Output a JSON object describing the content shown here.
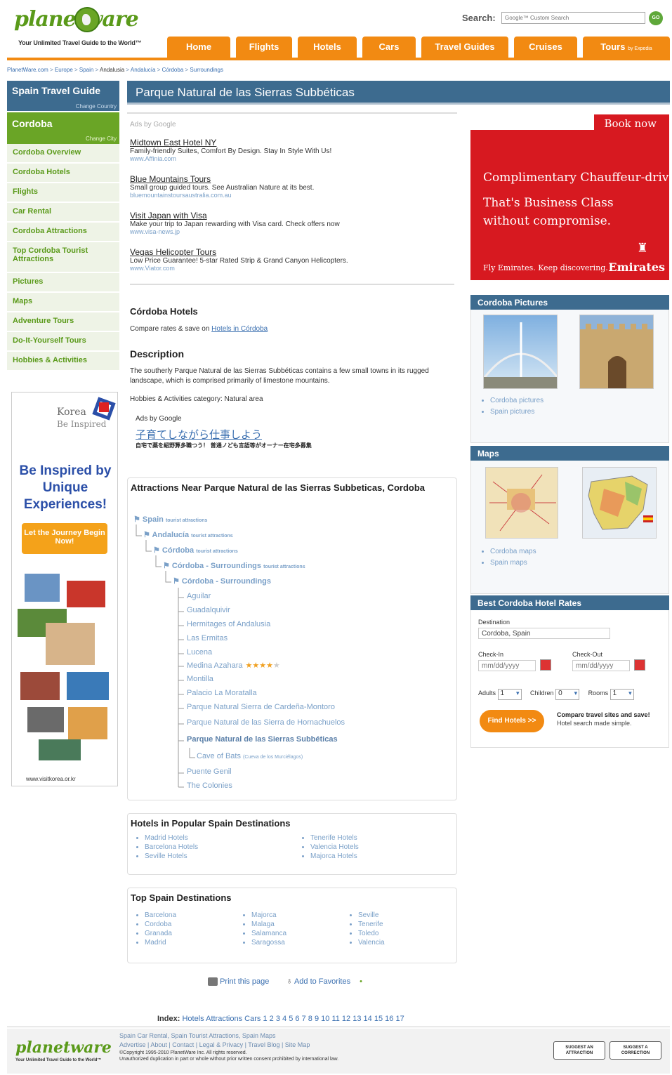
{
  "header": {
    "logo_text": "planetware",
    "tagline": "Your Unlimited Travel Guide to the World™",
    "search_label": "Search:",
    "search_placeholder": "Google™ Custom Search",
    "search_button": "GO"
  },
  "nav": {
    "tabs": [
      "Home",
      "Flights",
      "Hotels",
      "Cars",
      "Travel Guides",
      "Cruises",
      "Tours"
    ],
    "tours_suffix": "by Expedia"
  },
  "breadcrumb": [
    "PlanetWare.com",
    "Europe",
    "Spain",
    "Andalusia",
    "Andalucía",
    "Córdoba",
    "Surroundings"
  ],
  "breadcrumb_sep": ">",
  "sidebar": {
    "guide_title": "Spain Travel Guide",
    "change_country": "Change Country",
    "city": "Cordoba",
    "change_city": "Change City",
    "items": [
      "Cordoba Overview",
      "Cordoba Hotels",
      "Flights",
      "Car Rental",
      "Cordoba Attractions",
      "Top Cordoba Tourist Attractions",
      "Pictures",
      "Maps",
      "Adventure Tours",
      "Do-It-Yourself Tours",
      "Hobbies & Activities"
    ]
  },
  "korea_ad": {
    "brand": "Korea",
    "brand_sub": "Be Inspired",
    "headline": "Be Inspired by Unique Experiences!",
    "cta": "Let the Journey Begin Now!",
    "url": "www.visitkorea.or.kr"
  },
  "main": {
    "title": "Parque Natural de las Sierras Subbéticas",
    "ads_label": "Ads by Google",
    "ads": [
      {
        "title": "Midtown East Hotel NY",
        "desc": "Family-friendly Suites, Comfort By Design. Stay In Style With Us!",
        "url": "www.Affinia.com"
      },
      {
        "title": "Blue Mountains Tours",
        "desc": "Small group guided tours. See Australian Nature at its best.",
        "url": "bluemountainstoursaustralia.com.au"
      },
      {
        "title": "Visit Japan with Visa",
        "desc": "Make your trip to Japan rewarding with Visa card. Check offers now",
        "url": "www.visa-news.jp"
      },
      {
        "title": "Vegas Helicopter Tours",
        "desc": "Low Price Guarantee! 5-star Rated Strip & Grand Canyon Helicopters.",
        "url": "www.Viator.com"
      }
    ],
    "hotels_heading": "Córdoba Hotels",
    "hotels_text": "Compare rates & save on",
    "hotels_link": "Hotels in Córdoba",
    "desc_heading": "Description",
    "desc_text": "The southerly Parque Natural de las Sierras Subbéticas contains a few small towns in its rugged landscape, which is comprised primarily of limestone mountains.",
    "category_label": "Hobbies & Activities category:",
    "category_value": "Natural area",
    "ads2_label": "Ads by Google",
    "ad_jp_title": "子育てしながら仕事しよう",
    "ad_jp_desc": "自宅で薬を紹野算多職つう！ 普通ノども言語等がオーナー在宅多募集"
  },
  "attractions": {
    "heading": "Attractions Near Parque Natural de las Sierras Subbeticas, Cordoba",
    "tree": [
      {
        "label": "Spain",
        "suffix": "tourist attractions"
      },
      {
        "label": "Andalucía",
        "suffix": "tourist attractions"
      },
      {
        "label": "Córdoba",
        "suffix": "tourist attractions"
      },
      {
        "label": "Córdoba - Surroundings",
        "suffix": "tourist attractions"
      },
      {
        "label": "Córdoba - Surroundings",
        "suffix": ""
      }
    ],
    "places": [
      "Aguilar",
      "Guadalquivir",
      "Hermitages of Andalusia",
      "Las Ermitas",
      "Lucena",
      "Medina Azahara",
      "Montilla",
      "Palacio La Moratalla",
      "Parque Natural Sierra de Cardeña-Montoro",
      "Parque Natural de las Sierra de Hornachuelos",
      "Parque Natural de las Sierras Subbéticas",
      "Cave of Bats",
      "Puente Genil",
      "The Colonies"
    ],
    "cave_sub": "(Cueva de los Murciélagos)",
    "medina_stars": 4,
    "medina_stars_max": 5
  },
  "popular": {
    "heading": "Hotels in Popular Spain Destinations",
    "col1": [
      "Madrid Hotels",
      "Barcelona Hotels",
      "Seville Hotels"
    ],
    "col2": [
      "Tenerife Hotels",
      "Valencia Hotels",
      "Majorca Hotels"
    ]
  },
  "top_dest": {
    "heading": "Top Spain Destinations",
    "col1": [
      "Barcelona",
      "Cordoba",
      "Granada",
      "Madrid"
    ],
    "col2": [
      "Majorca",
      "Malaga",
      "Salamanca",
      "Saragossa"
    ],
    "col3": [
      "Seville",
      "Tenerife",
      "Toledo",
      "Valencia"
    ]
  },
  "actions": {
    "print": "Print this page",
    "favorites": "Add to Favorites"
  },
  "index": {
    "label": "Index:",
    "links": [
      "Hotels",
      "Attractions",
      "Cars"
    ],
    "numbers": [
      "1",
      "2",
      "3",
      "4",
      "5",
      "6",
      "7",
      "8",
      "9",
      "10",
      "11",
      "12",
      "13",
      "14",
      "15",
      "16",
      "17"
    ]
  },
  "emirates": {
    "book": "Book now",
    "line1": "Complimentary Chauffeur-drive.",
    "line2": "That's Business Class",
    "line3": "without compromise.",
    "tagline": "Fly Emirates. Keep discovering.",
    "brand": "Emirates"
  },
  "pictures": {
    "heading": "Cordoba Pictures",
    "links": [
      "Cordoba pictures",
      "Spain pictures"
    ]
  },
  "maps": {
    "heading": "Maps",
    "links": [
      "Cordoba maps",
      "Spain maps"
    ]
  },
  "hotel_rates": {
    "heading": "Best Cordoba Hotel Rates",
    "dest_label": "Destination",
    "dest_value": "Cordoba, Spain",
    "checkin_label": "Check-In",
    "checkout_label": "Check-Out",
    "date_placeholder": "mm/dd/yyyy",
    "adults_label": "Adults",
    "adults": "1",
    "children_label": "Children",
    "children": "0",
    "rooms_label": "Rooms",
    "rooms": "1",
    "find_button": "Find Hotels >>",
    "compare_title": "Compare travel sites and save!",
    "compare_sub": "Hotel search made simple."
  },
  "footer": {
    "links1": "Spain Car Rental, Spain Tourist Attractions, Spain Maps",
    "links2": "Advertise | About | Contact | Legal & Privacy | Travel Blog | Site Map",
    "copyright": "©Copyright 1995-2010 PlanetWare Inc. All rights reserved.",
    "notice": "Unauthorized duplication in part or whole without prior written consent prohibited by international law.",
    "badge1": "SUGGEST AN ATTRACTION",
    "badge2": "SUGGEST A CORRECTION"
  },
  "colors": {
    "orange": "#f28a12",
    "blue": "#3d6b8f",
    "green": "#6aa526",
    "emirates_red": "#d71920"
  }
}
